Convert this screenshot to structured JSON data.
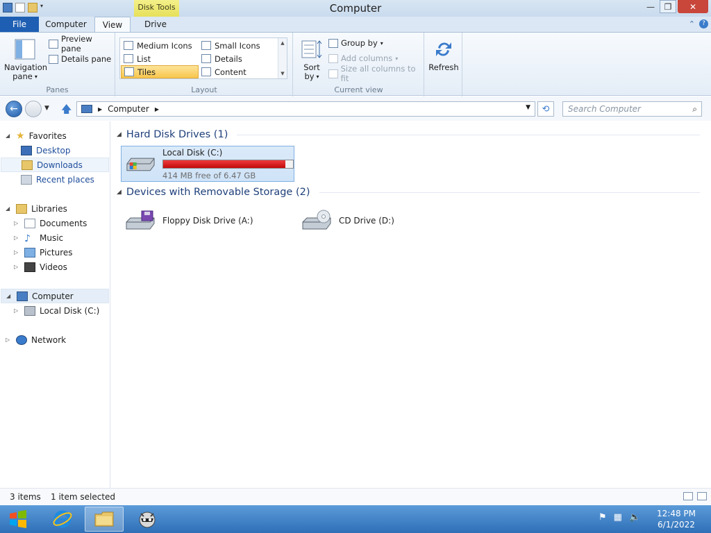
{
  "window": {
    "title": "Computer",
    "context_tab": "Disk Tools",
    "controls": {
      "minimize": "—",
      "maximize": "❐",
      "close": "✕"
    }
  },
  "tabs": [
    "File",
    "Computer",
    "View",
    "Drive"
  ],
  "ribbon": {
    "panes": {
      "label": "Panes",
      "navigation_pane": "Navigation",
      "navigation_pane2": "pane",
      "preview_pane": "Preview pane",
      "details_pane": "Details pane"
    },
    "layout": {
      "label": "Layout",
      "items": [
        "Medium Icons",
        "Small Icons",
        "List",
        "Details",
        "Tiles",
        "Content"
      ],
      "selected": "Tiles"
    },
    "current_view": {
      "label": "Current view",
      "sort_by": "Sort",
      "sort_by2": "by",
      "group_by": "Group by",
      "add_columns": "Add columns",
      "size_all_columns": "Size all columns to fit"
    },
    "refresh": "Refresh"
  },
  "address": {
    "path": "Computer",
    "search_placeholder": "Search Computer"
  },
  "nav_pane": {
    "favorites": "Favorites",
    "desktop": "Desktop",
    "downloads": "Downloads",
    "recent_places": "Recent places",
    "libraries": "Libraries",
    "documents": "Documents",
    "music": "Music",
    "pictures": "Pictures",
    "videos": "Videos",
    "computer": "Computer",
    "local_disk": "Local Disk (C:)",
    "network": "Network"
  },
  "content": {
    "hard_disk_header": "Hard Disk Drives (1)",
    "removable_header": "Devices with Removable Storage (2)",
    "local_disk": {
      "name": "Local Disk (C:)",
      "free": "414 MB free of 6.47 GB",
      "used_fraction": 0.94
    },
    "floppy": "Floppy Disk Drive (A:)",
    "cd": "CD Drive (D:)"
  },
  "status": {
    "items": "3 items",
    "selected": "1 item selected"
  },
  "taskbar": {
    "time": "12:48 PM",
    "date": "6/1/2022"
  }
}
